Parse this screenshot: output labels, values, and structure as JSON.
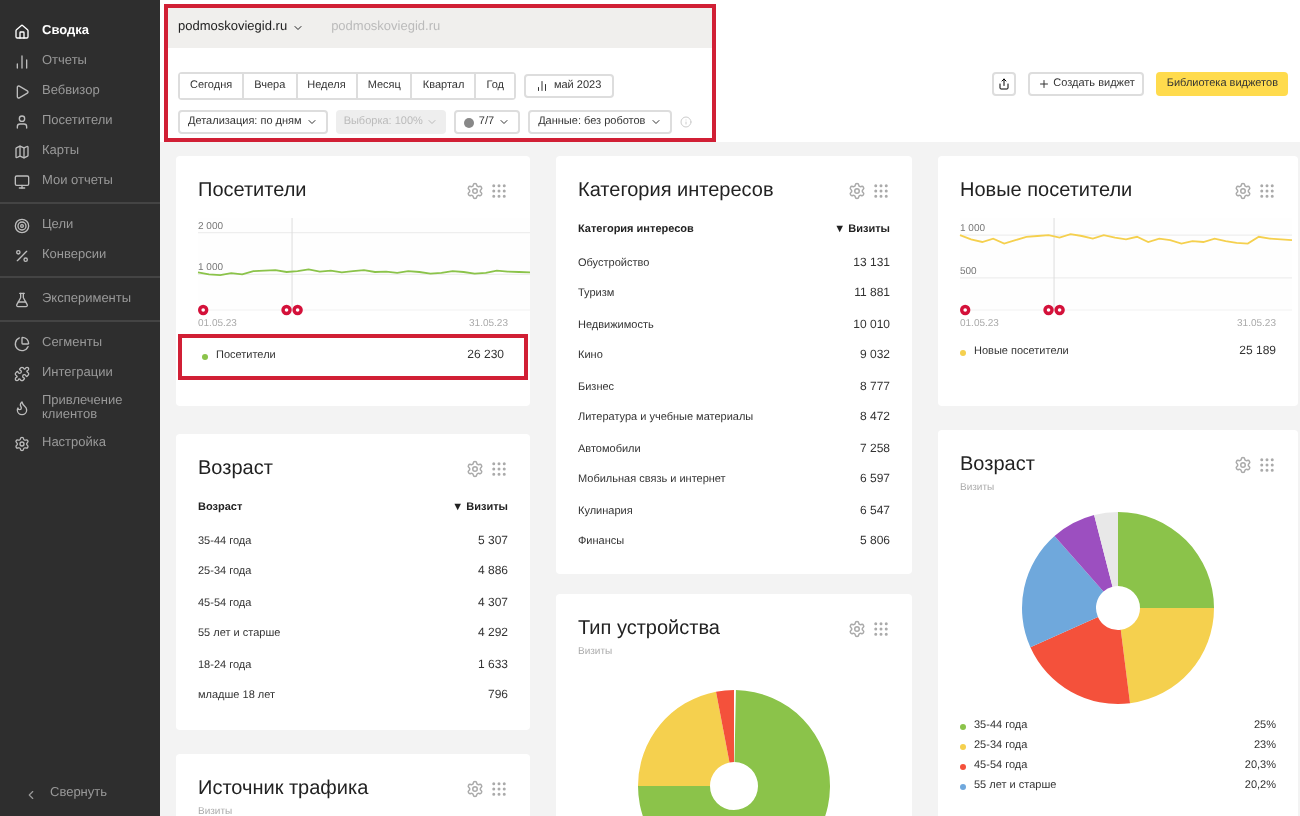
{
  "sidebar": {
    "groups": [
      {
        "items": [
          {
            "label": "Сводка",
            "selected": true
          },
          {
            "label": "Отчеты",
            "selected": false
          },
          {
            "label": "Вебвизор",
            "selected": false
          },
          {
            "label": "Посетители",
            "selected": false
          },
          {
            "label": "Карты",
            "selected": false
          },
          {
            "label": "Мои отчеты",
            "selected": false
          }
        ]
      },
      {
        "items": [
          {
            "label": "Цели",
            "selected": false
          },
          {
            "label": "Конверсии",
            "selected": false
          }
        ]
      },
      {
        "items": [
          {
            "label": "Эксперименты",
            "selected": false
          }
        ]
      },
      {
        "items": [
          {
            "label": "Сегменты",
            "selected": false
          },
          {
            "label": "Интеграции",
            "selected": false
          },
          {
            "label": "Привлечение клиентов",
            "selected": false
          },
          {
            "label": "Настройка",
            "selected": false
          }
        ]
      }
    ],
    "collapse": "Свернуть"
  },
  "header": {
    "highlight": true,
    "site": "podmoskoviegid.ru",
    "site_secondary": "podmoskoviegid.ru",
    "periods": [
      {
        "label": "Сегодня",
        "selected": false
      },
      {
        "label": "Вчера",
        "selected": false
      },
      {
        "label": "Неделя",
        "selected": false
      },
      {
        "label": "Месяц",
        "selected": false
      },
      {
        "label": "Квартал",
        "selected": false
      },
      {
        "label": "Год",
        "selected": false
      }
    ],
    "month": "май 2023",
    "filters": [
      {
        "label": "Детализация: по дням",
        "kind": "dropdown",
        "disabled": false
      },
      {
        "label": "Выборка: 100%",
        "kind": "dropdown",
        "disabled": true
      },
      {
        "label": "7/7",
        "kind": "counter",
        "disabled": false
      },
      {
        "label": "Данные: без роботов",
        "kind": "dropdown",
        "disabled": false
      }
    ]
  },
  "actions": {
    "create": "Создать виджет",
    "library": "Библиотека виджетов"
  },
  "visitors": {
    "title": "Посетители",
    "x_start": "01.05.23",
    "x_end": "31.05.23",
    "chart_data": {
      "type": "line",
      "series": [
        {
          "name": "Посетители",
          "color": "#8bc34a",
          "values": [
            1050,
            1000,
            980,
            1030,
            1000,
            1080,
            1090,
            1100,
            1060,
            1080,
            1120,
            1070,
            1090,
            1050,
            1080,
            1100,
            1060,
            1070,
            1040,
            1080,
            1060,
            1020,
            1040,
            1080,
            1060,
            1020,
            1040,
            1090,
            1070,
            1060,
            1050
          ]
        }
      ],
      "ylim": [
        150,
        2350
      ],
      "yticks": [
        {
          "value": 1000,
          "label": "1 000"
        },
        {
          "value": 2000,
          "label": "2 000"
        }
      ]
    },
    "total": "26 230",
    "highlight": true
  },
  "interests": {
    "title": "Категория интересов",
    "columns": [
      "Категория интересов",
      "▼ Визиты"
    ],
    "rows": [
      [
        "Обустройство",
        "13 131"
      ],
      [
        "Туризм",
        "11 881"
      ],
      [
        "Недвижимость",
        "10 010"
      ],
      [
        "Кино",
        "9 032"
      ],
      [
        "Бизнес",
        "8 777"
      ],
      [
        "Литература и учебные материалы",
        "8 472"
      ],
      [
        "Автомобили",
        "7 258"
      ],
      [
        "Мобильная связь и интернет",
        "6 597"
      ],
      [
        "Кулинария",
        "6 547"
      ],
      [
        "Финансы",
        "5 806"
      ]
    ]
  },
  "new_visitors": {
    "title": "Новые посетители",
    "x_start": "01.05.23",
    "x_end": "31.05.23",
    "chart_data": {
      "type": "line",
      "series": [
        {
          "name": "Новые посетители",
          "color": "#f5d04e",
          "values": [
            1000,
            950,
            920,
            960,
            900,
            940,
            980,
            990,
            1000,
            970,
            1010,
            990,
            960,
            1000,
            970,
            950,
            980,
            920,
            960,
            940,
            900,
            930,
            920,
            960,
            930,
            910,
            900,
            980,
            960,
            950,
            940
          ]
        }
      ],
      "ylim": [
        125,
        1200
      ],
      "yticks": [
        {
          "value": 500,
          "label": "500"
        },
        {
          "value": 1000,
          "label": "1 000"
        }
      ]
    },
    "total": "25 189",
    "highlight": false
  },
  "age_table": {
    "title": "Возраст",
    "columns": [
      "Возраст",
      "▼ Визиты"
    ],
    "rows": [
      [
        "35-44 года",
        "5 307"
      ],
      [
        "25-34 года",
        "4 886"
      ],
      [
        "45-54 года",
        "4 307"
      ],
      [
        "55 лет и старше",
        "4 292"
      ],
      [
        "18-24 года",
        "1 633"
      ],
      [
        "младше 18 лет",
        "796"
      ]
    ]
  },
  "device": {
    "title": "Тип устройства",
    "subtitle": "Визиты"
  },
  "age_pie": {
    "title": "Возраст",
    "subtitle": "Визиты",
    "chart_data": {
      "type": "donut",
      "values": [
        25,
        23,
        20.3,
        20.2,
        7.5,
        4
      ]
    },
    "legend": [
      {
        "label": "35-44 года",
        "value": "25%",
        "color": "#8bc34a"
      },
      {
        "label": "25-34 года",
        "value": "23%",
        "color": "#f5d04e"
      },
      {
        "label": "45-54 года",
        "value": "20,3%",
        "color": "#f4513b"
      },
      {
        "label": "55 лет и старше",
        "value": "20,2%",
        "color": "#6fa8dc"
      }
    ]
  },
  "traffic": {
    "title": "Источник трафика",
    "subtitle": "Визиты"
  }
}
